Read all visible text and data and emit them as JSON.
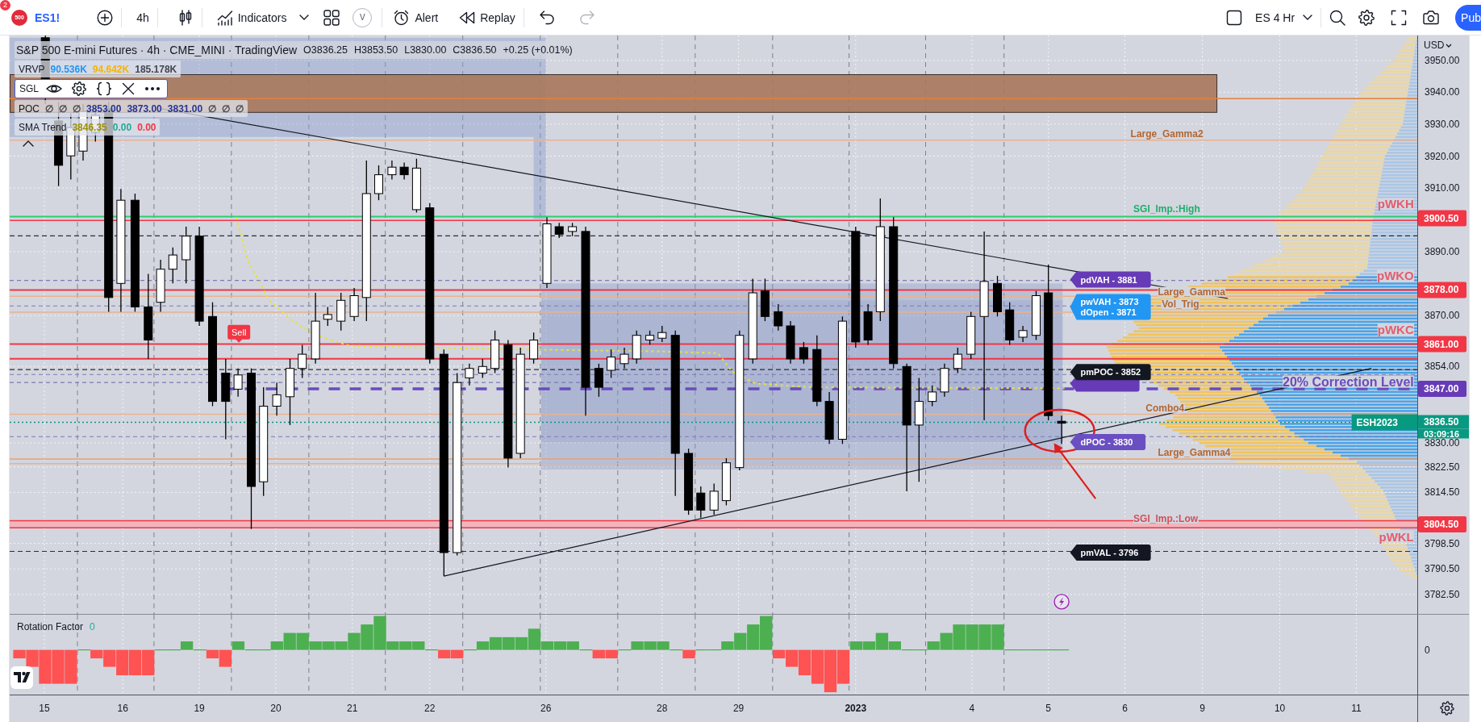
{
  "toolbar": {
    "notification_count": "2",
    "symbol_logo": "500",
    "symbol": "ES1!",
    "interval": "4h",
    "indicators": "Indicators",
    "template": "V",
    "alert": "Alert",
    "replay": "Replay",
    "undo": {
      "disabled": false
    },
    "redo": {
      "disabled": true
    },
    "layout_name": "ES 4 Hr",
    "publish": "Pub"
  },
  "legend": {
    "title": "S&P 500 E-mini Futures · 4h · CME_MINI · TradingView",
    "ohlc": [
      "O3836.25",
      "H3853.50",
      "L3830.00",
      "C3836.50",
      "+0.25 (+0.01%)"
    ],
    "indicators": [
      {
        "kind": "values",
        "name": "VRVP",
        "values": [
          {
            "text": "90.536K",
            "color": "#2196f3"
          },
          {
            "text": "94.642K",
            "color": "#f5b400"
          },
          {
            "text": "185.178K",
            "color": "#434651"
          }
        ]
      },
      {
        "kind": "controls",
        "name": "SGL"
      },
      {
        "kind": "values",
        "name": "POC",
        "values": [
          {
            "text": "∅",
            "color": "#434651"
          },
          {
            "text": "∅",
            "color": "#434651"
          },
          {
            "text": "∅",
            "color": "#434651"
          },
          {
            "text": "3853.00",
            "color": "#283593"
          },
          {
            "text": "3873.00",
            "color": "#283593"
          },
          {
            "text": "3831.00",
            "color": "#283593"
          },
          {
            "text": "∅",
            "color": "#434651"
          },
          {
            "text": "∅",
            "color": "#434651"
          },
          {
            "text": "∅",
            "color": "#434651"
          }
        ]
      },
      {
        "kind": "values",
        "name": "SMA Trend",
        "values": [
          {
            "text": "3846.35",
            "color": "#9a8f00"
          },
          {
            "text": "0.00",
            "color": "#22ab94"
          },
          {
            "text": "0.00",
            "color": "#f23645"
          }
        ]
      }
    ]
  },
  "chart": {
    "sell_signal": "Sell",
    "level_labels": [
      {
        "text": "Large_Gamma2",
        "kind": "level",
        "color": "#b5672f"
      },
      {
        "text": "pWKH",
        "kind": "weekly",
        "color": "#e35d70"
      },
      {
        "text": "SGI_Imp.:High",
        "kind": "level",
        "color": "#1fae6a"
      },
      {
        "text": "pWKO",
        "kind": "weekly",
        "color": "#e35d70"
      },
      {
        "text": "Large_Gamma",
        "kind": "level",
        "color": "#b5672f"
      },
      {
        "text": "Vol_Trig",
        "kind": "level",
        "color": "#b5672f"
      },
      {
        "text": "pWKC",
        "kind": "weekly",
        "color": "#e35d70"
      },
      {
        "text": "20% Correction Level",
        "kind": "correction",
        "color": "#6a4bbd"
      },
      {
        "text": "Combo4",
        "kind": "level",
        "color": "#b5672f"
      },
      {
        "text": "Large_Gamma4",
        "kind": "level",
        "color": "#b5672f"
      },
      {
        "text": "SGI_Imp.:Low",
        "kind": "level",
        "color": "#d0505a"
      },
      {
        "text": "pWKL",
        "kind": "weekly",
        "color": "#e35d70"
      }
    ],
    "price_tags": [
      {
        "lines": [
          "pdVAH - 3881"
        ],
        "color": "#673ab7"
      },
      {
        "lines": [
          "pwVAH - 3873",
          "dOpen - 3871"
        ],
        "color": "#2196f3"
      },
      {
        "lines": [
          "pmPOC - 3852"
        ],
        "color": "#131722"
      },
      {
        "color": "#673ab7"
      },
      {
        "lines": [
          "dPOC - 3830"
        ],
        "color": "#6a4fc2"
      },
      {
        "lines": [
          "pmVAL - 3796"
        ],
        "color": "#131722"
      }
    ]
  },
  "price_axis": {
    "currency": "USD",
    "labels": [
      {
        "kind": "tick",
        "text": "3950.00"
      },
      {
        "kind": "tick",
        "text": "3940.00"
      },
      {
        "kind": "tick",
        "text": "3930.00"
      },
      {
        "kind": "tick",
        "text": "3920.00"
      },
      {
        "kind": "tick",
        "text": "3910.00"
      },
      {
        "kind": "marker",
        "text": "3900.50",
        "color": "#f23645"
      },
      {
        "kind": "tick",
        "text": "3890.00"
      },
      {
        "kind": "marker",
        "text": "3878.00",
        "color": "#f23645"
      },
      {
        "kind": "tick",
        "text": "3870.00"
      },
      {
        "kind": "marker",
        "text": "3861.00",
        "color": "#f23645"
      },
      {
        "kind": "tick",
        "text": "3854.00"
      },
      {
        "kind": "marker",
        "text": "3847.00",
        "color": "#673ab7"
      },
      {
        "kind": "marker",
        "text": "3836.50",
        "color": "#089981",
        "countdown": "03:09:16",
        "symbol": "ESH2023"
      },
      {
        "kind": "tick",
        "text": "3830.00"
      },
      {
        "kind": "tick",
        "text": "3822.50"
      },
      {
        "kind": "tick",
        "text": "3814.50"
      },
      {
        "kind": "marker",
        "text": "3804.50",
        "color": "#f23645"
      },
      {
        "kind": "tick",
        "text": "3798.50"
      },
      {
        "kind": "tick",
        "text": "3790.50"
      },
      {
        "kind": "tick",
        "text": "3782.50"
      }
    ]
  },
  "rotation_factor": {
    "title": "Rotation Factor",
    "value": "0",
    "axis_label": "0"
  },
  "time_axis": {
    "labels": [
      {
        "text": "15",
        "kind": "day"
      },
      {
        "text": "16",
        "kind": "day"
      },
      {
        "text": "19",
        "kind": "day"
      },
      {
        "text": "20",
        "kind": "day"
      },
      {
        "text": "21",
        "kind": "day"
      },
      {
        "text": "22",
        "kind": "day"
      },
      {
        "text": "26",
        "kind": "day"
      },
      {
        "text": "28",
        "kind": "day"
      },
      {
        "text": "29",
        "kind": "day"
      },
      {
        "text": "2023",
        "kind": "year"
      },
      {
        "text": "4",
        "kind": "day"
      },
      {
        "text": "5",
        "kind": "day"
      },
      {
        "text": "6",
        "kind": "day"
      },
      {
        "text": "9",
        "kind": "day"
      },
      {
        "text": "10",
        "kind": "day"
      },
      {
        "text": "11",
        "kind": "day"
      }
    ]
  }
}
